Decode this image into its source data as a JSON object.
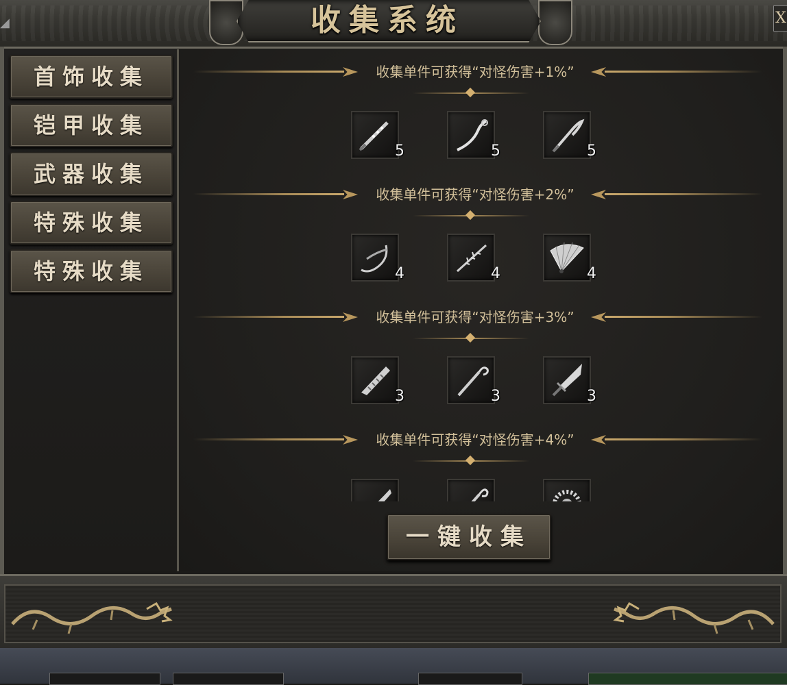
{
  "window": {
    "title": "收集系统",
    "close_label": "X"
  },
  "sidebar": {
    "tabs": [
      {
        "label": "首饰收集"
      },
      {
        "label": "铠甲收集"
      },
      {
        "label": "武器收集"
      },
      {
        "label": "特殊收集"
      },
      {
        "label": "特殊收集"
      }
    ],
    "selected_index": 2
  },
  "tiers": [
    {
      "title": "收集单件可获得“对怪伤害+1%”",
      "items": [
        {
          "icon": "studded-club-icon",
          "count": "5"
        },
        {
          "icon": "curved-staff-icon",
          "count": "5"
        },
        {
          "icon": "hook-blade-icon",
          "count": "5"
        }
      ]
    },
    {
      "title": "收集单件可获得“对怪伤害+2%”",
      "items": [
        {
          "icon": "crescent-blade-icon",
          "count": "4"
        },
        {
          "icon": "thorned-sword-icon",
          "count": "4"
        },
        {
          "icon": "war-fan-icon",
          "count": "4"
        }
      ]
    },
    {
      "title": "收集单件可获得“对怪伤害+3%”",
      "items": [
        {
          "icon": "saw-blade-icon",
          "count": "3"
        },
        {
          "icon": "crook-staff-icon",
          "count": "3"
        },
        {
          "icon": "broad-sword-icon",
          "count": "3"
        }
      ]
    },
    {
      "title": "收集单件可获得“对怪伤害+4%”",
      "items": [
        {
          "icon": "sabre-icon",
          "count": ""
        },
        {
          "icon": "spiral-staff-icon",
          "count": ""
        },
        {
          "icon": "spiked-wheel-icon",
          "count": ""
        }
      ]
    }
  ],
  "actions": {
    "collect_all_label": "一键收集"
  }
}
